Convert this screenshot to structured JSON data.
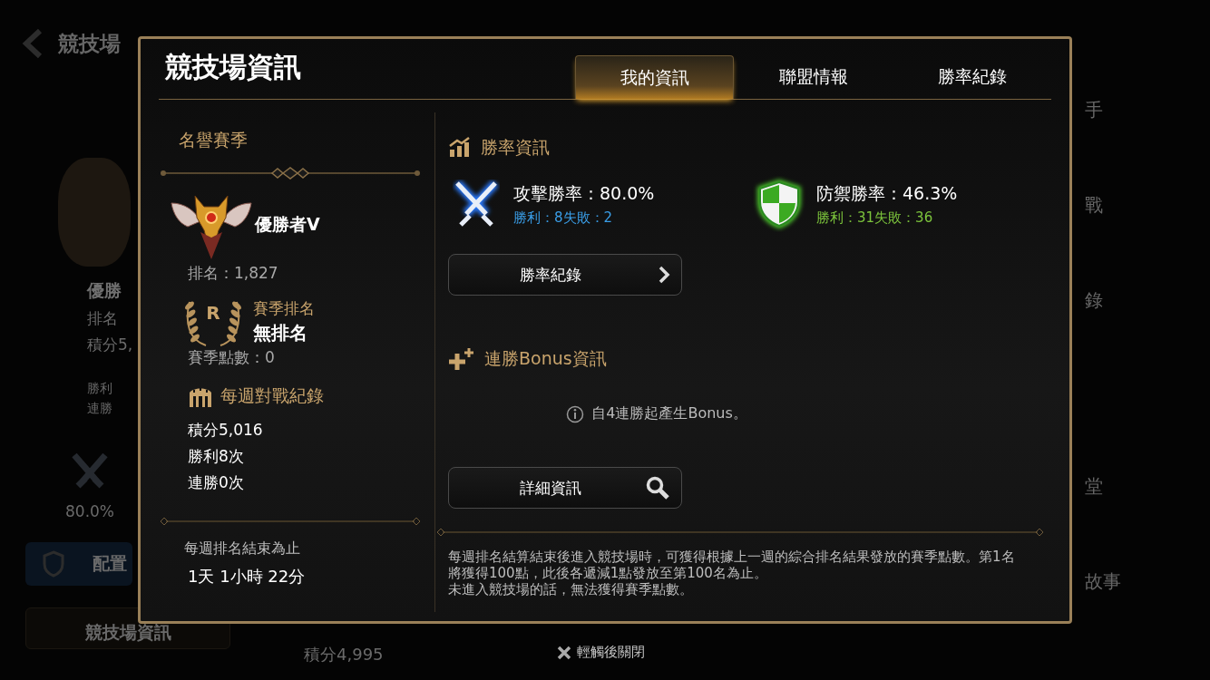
{
  "background": {
    "title": "競技場",
    "left_items": [
      {
        "kind": "title",
        "text": "優勝"
      },
      {
        "kind": "rank",
        "text": "排名"
      },
      {
        "kind": "text",
        "text": "積分5,"
      },
      {
        "kind": "small",
        "text": "勝利"
      },
      {
        "kind": "small",
        "text": "連勝"
      },
      {
        "kind": "swords",
        "text": "80.0%"
      },
      {
        "kind": "button",
        "text": "配置"
      }
    ],
    "bottom_button": "競技場資訊",
    "bottom_score": "積分4,995",
    "right_items": [
      "手",
      "戰",
      "錄",
      "堂",
      "故事"
    ]
  },
  "dialog": {
    "title": "競技場資訊",
    "tabs": [
      {
        "label": "我的資訊",
        "selected": true
      },
      {
        "label": "聯盟情報",
        "selected": false
      },
      {
        "label": "勝率紀錄",
        "selected": false
      }
    ],
    "season": {
      "heading": "名譽賽季",
      "tier": "優勝者V",
      "rank": "排名：1,827",
      "season_rank_label": "賽季排名",
      "season_rank_icon_letter": "R",
      "season_rank": "無排名",
      "season_points": "賽季點數：0"
    },
    "weekly": {
      "heading": "每週對戰紀錄",
      "lines": [
        "積分5,016",
        "勝利8次",
        "連勝0次"
      ],
      "deadline_label": "每週排名結束為止",
      "deadline": "1天 1小時 22分"
    },
    "win_rate": {
      "heading": "勝率資訊",
      "stats": [
        {
          "kind": "attack",
          "title": "攻擊勝率：80.0%",
          "record": "勝利：8失敗：2",
          "color": "#3a9ee8"
        },
        {
          "kind": "defense",
          "title": "防禦勝率：46.3%",
          "record": "勝利：31失敗：36",
          "color": "#7cc43c"
        }
      ],
      "button": "勝率紀錄"
    },
    "bonus": {
      "heading": "連勝Bonus資訊",
      "info": "自4連勝起產生Bonus。",
      "button": "詳細資訊"
    },
    "notice": [
      "每週排名結算結束後進入競技場時，可獲得根據上一週的綜合排名結果發放的賽季點數。第1名將獲得100點，此後各遞減1點發放至第100名為止。",
      "未進入競技場的話，無法獲得賽季點數。"
    ]
  },
  "close_hint": "輕觸後關閉"
}
